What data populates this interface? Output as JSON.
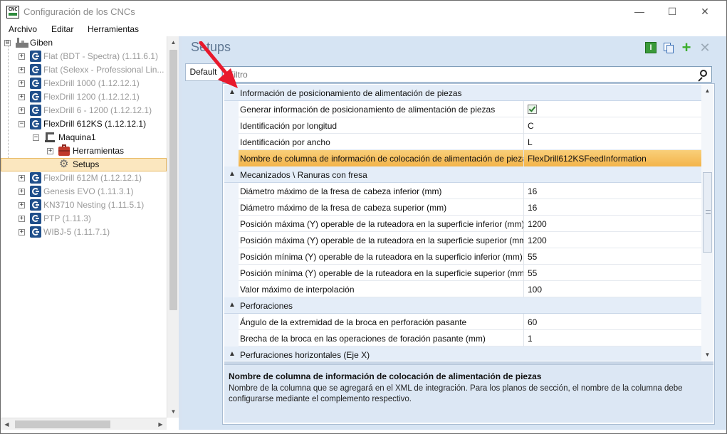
{
  "window": {
    "title": "Configuración de los CNCs",
    "app_icon_text": "CNC",
    "minimize_glyph": "—",
    "maximize_glyph": "☐",
    "close_glyph": "✕"
  },
  "menu": {
    "items": [
      "Archivo",
      "Editar",
      "Herramientas"
    ]
  },
  "tree": {
    "root": {
      "label": "Giben",
      "expander": "⊟"
    },
    "items": [
      {
        "label": "Flat (BDT - Spectra) (1.11.6.1)",
        "expander": "+"
      },
      {
        "label": "Flat (Selexx - Professional Lin...",
        "expander": "+"
      },
      {
        "label": "FlexDrill 1000 (1.12.12.1)",
        "expander": "+"
      },
      {
        "label": "FlexDrill 1200 (1.12.12.1)",
        "expander": "+"
      },
      {
        "label": "FlexDrill 6 - 1200 (1.12.12.1)",
        "expander": "+"
      },
      {
        "label": "FlexDrill 612KS (1.12.12.1)",
        "expander": "−"
      },
      {
        "label": "FlexDrill 612M (1.12.12.1)",
        "expander": "+"
      },
      {
        "label": "Genesis EVO (1.11.3.1)",
        "expander": "+"
      },
      {
        "label": "KN3710 Nesting (1.11.5.1)",
        "expander": "+"
      },
      {
        "label": "PTP (1.11.3)",
        "expander": "+"
      },
      {
        "label": "WIBJ-5 (1.11.7.1)",
        "expander": "+"
      }
    ],
    "machine": {
      "label": "Maquina1",
      "expander": "−"
    },
    "tools": {
      "label": "Herramientas",
      "expander": "+"
    },
    "setups": {
      "label": "Setups"
    }
  },
  "panel": {
    "title": "Setups",
    "tab_label": "Default",
    "filter_value": "Filtro"
  },
  "grid": {
    "categories": [
      {
        "label": "Información de posicionamiento de alimentación de piezas",
        "rows": [
          {
            "name": "Generar información de posicionamiento de alimentación de piezas",
            "value": "",
            "checkbox": true
          },
          {
            "name": "Identificación por longitud",
            "value": "C"
          },
          {
            "name": "Identificación por ancho",
            "value": "L"
          },
          {
            "name": "Nombre de columna de información de colocación de alimentación de piezas",
            "value": "FlexDrill612KSFeedInformation",
            "selected": true
          }
        ]
      },
      {
        "label": "Mecanizados \\ Ranuras con fresa",
        "rows": [
          {
            "name": "Diámetro máximo de la fresa de cabeza inferior (mm)",
            "value": "16"
          },
          {
            "name": "Diámetro máximo de la fresa de cabeza superior (mm)",
            "value": "16"
          },
          {
            "name": "Posición máxima (Y) operable de la ruteadora en la superficie inferior (mm)",
            "value": "1200"
          },
          {
            "name": "Posición máxima (Y) operable de la ruteadora en la superficie superior (mm)",
            "value": "1200"
          },
          {
            "name": "Posición mínima (Y) operable de la ruteadora en la superficio inferior (mm)",
            "value": "55"
          },
          {
            "name": "Posición mínima (Y) operable de la ruteadora en la superficie superior (mm)",
            "value": "55"
          },
          {
            "name": "Valor máximo de interpolación",
            "value": "100"
          }
        ]
      },
      {
        "label": "Perforaciones",
        "rows": [
          {
            "name": "Ángulo de la extremidad de la broca en perforación pasante",
            "value": "60"
          },
          {
            "name": "Brecha de la broca en las operaciones de foración pasante (mm)",
            "value": "1"
          }
        ]
      },
      {
        "label": "Perfuraciones horizontales (Eje X)",
        "rows": []
      }
    ]
  },
  "description": {
    "title": "Nombre de columna de información de colocación de alimentación de piezas",
    "text": "Nombre de la columna que se agregará en el XML de integración. Para los planos de sección, el nombre de la columna debe configurarse mediante el complemento respectivo."
  },
  "icons": {
    "app": "cnc-app-icon",
    "info": "info-icon",
    "copy": "copy-icon",
    "add": "add-icon",
    "delete": "close-icon",
    "search": "search-icon",
    "tree_node": "giben-g-icon"
  },
  "colors": {
    "selection_orange": "#f3b44a",
    "panel_blue": "#d6e4f3",
    "category_blue": "#e4edf8",
    "brand_blue": "#1f4f8b",
    "annotation_red": "#e8192c"
  }
}
